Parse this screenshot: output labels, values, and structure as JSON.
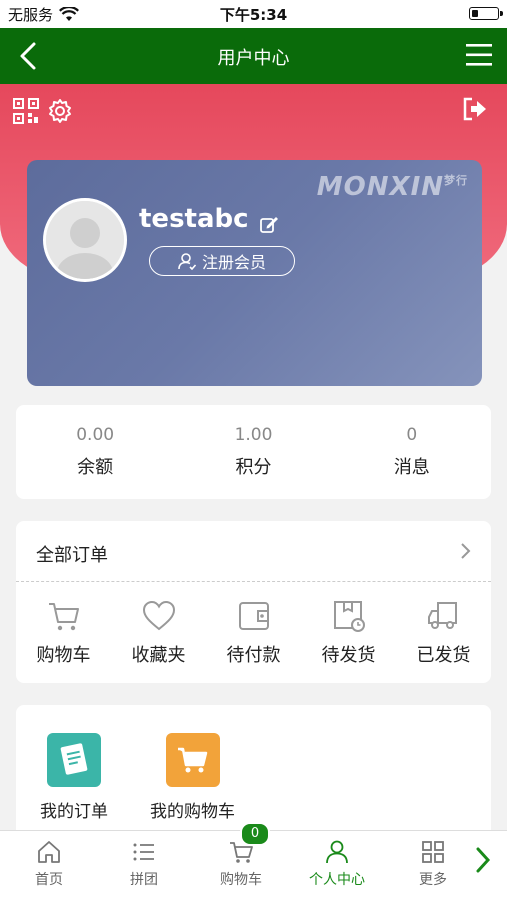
{
  "status_bar": {
    "carrier": "无服务",
    "time": "下午5:34"
  },
  "nav": {
    "title": "用户中心"
  },
  "profile": {
    "brand": "MONXIN",
    "brand_sub": "梦行",
    "username": "testabc",
    "member_button": "注册会员"
  },
  "stats": [
    {
      "value": "0.00",
      "label": "余额"
    },
    {
      "value": "1.00",
      "label": "积分"
    },
    {
      "value": "0",
      "label": "消息"
    }
  ],
  "orders": {
    "title": "全部订单",
    "items": [
      {
        "label": "购物车",
        "icon": "cart-icon"
      },
      {
        "label": "收藏夹",
        "icon": "heart-icon"
      },
      {
        "label": "待付款",
        "icon": "wallet-icon"
      },
      {
        "label": "待发货",
        "icon": "package-clock-icon"
      },
      {
        "label": "已发货",
        "icon": "truck-icon"
      }
    ]
  },
  "shortcuts": [
    {
      "label": "我的订单",
      "color": "#3bb5a8",
      "icon": "order-list-icon"
    },
    {
      "label": "我的购物车",
      "color": "#f2a33a",
      "icon": "cart-icon"
    }
  ],
  "tabs": [
    {
      "label": "首页",
      "icon": "home-icon"
    },
    {
      "label": "拼团",
      "icon": "list-icon"
    },
    {
      "label": "购物车",
      "icon": "cart-icon",
      "badge": "0"
    },
    {
      "label": "个人中心",
      "icon": "user-icon",
      "active": true
    },
    {
      "label": "更多",
      "icon": "grid-icon"
    }
  ],
  "colors": {
    "nav_green": "#0a6b0a",
    "active_green": "#1a8a1a",
    "header_red": "#e5485c"
  }
}
